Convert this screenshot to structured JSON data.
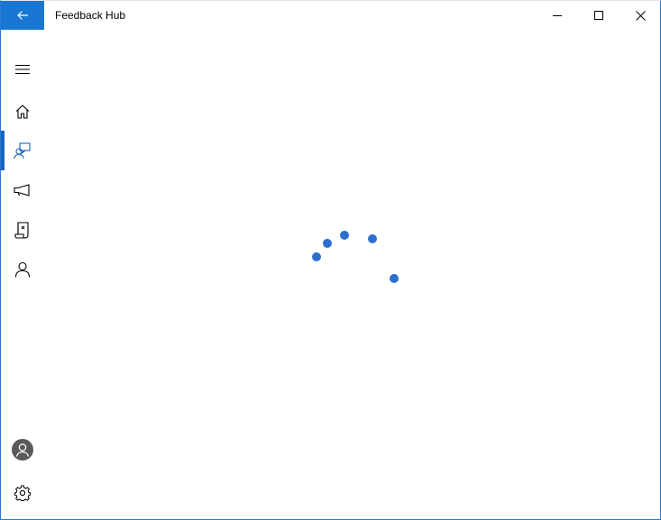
{
  "window": {
    "title": "Feedback Hub",
    "accent_color": "#1976d2"
  },
  "titlebar": {
    "back_icon": "arrow-left-icon",
    "minimize_icon": "minimize-icon",
    "maximize_icon": "maximize-icon",
    "close_icon": "close-icon"
  },
  "nav": {
    "items": [
      {
        "icon": "hamburger-icon"
      },
      {
        "icon": "home-icon"
      },
      {
        "icon": "feedback-icon",
        "selected": true
      },
      {
        "icon": "announcements-icon"
      },
      {
        "icon": "quests-icon"
      },
      {
        "icon": "achievements-icon"
      }
    ],
    "footer": [
      {
        "icon": "account-avatar-icon"
      },
      {
        "icon": "settings-gear-icon"
      }
    ]
  },
  "loading": {
    "icon": "progress-ring-icon",
    "dot_color": "#2b6fcf"
  }
}
